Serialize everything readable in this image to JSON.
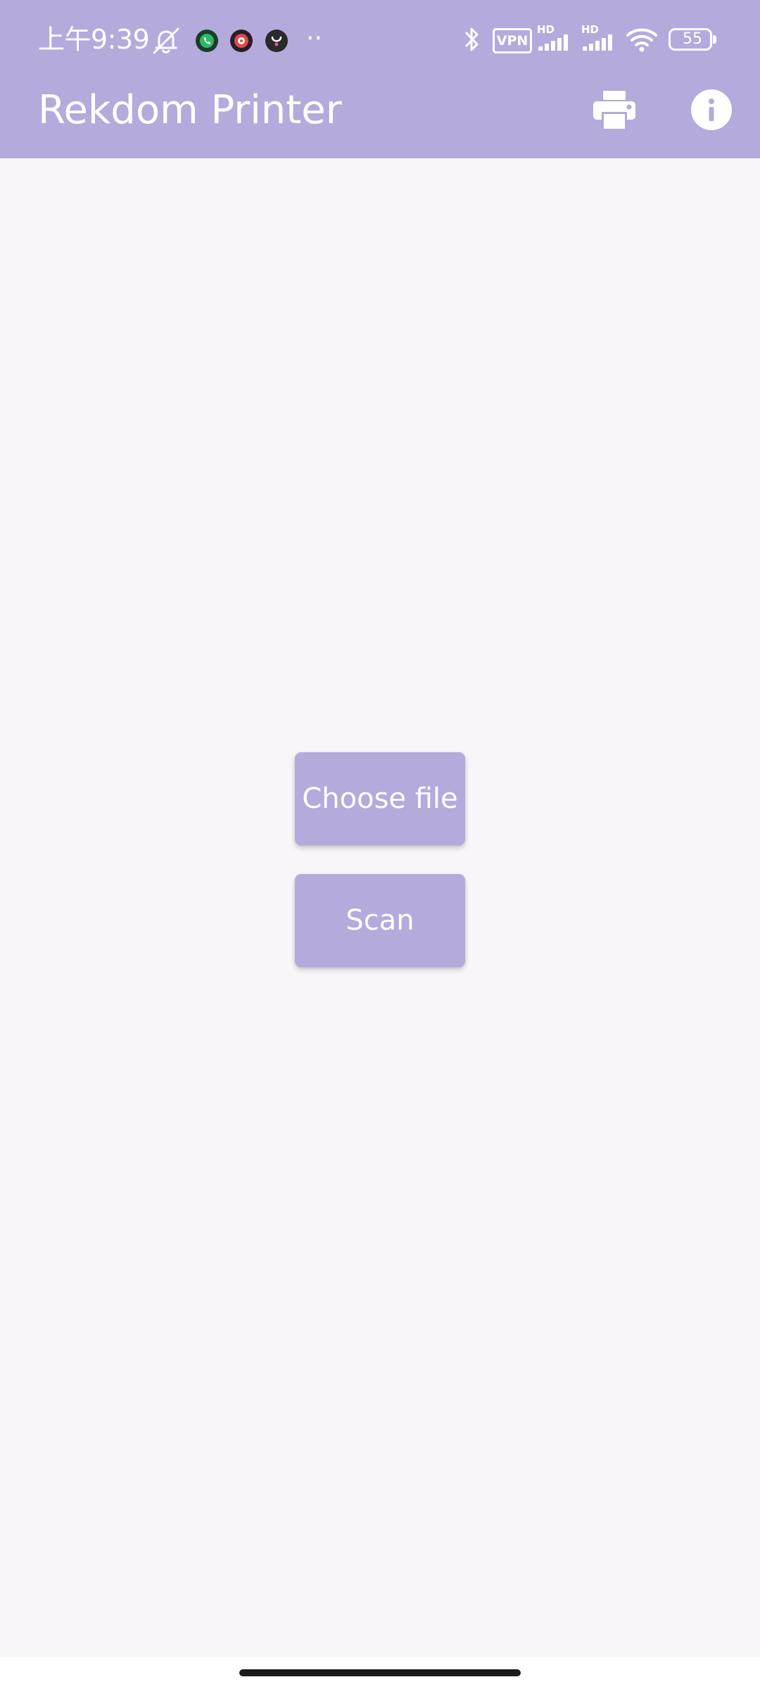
{
  "status_bar": {
    "time": "上午9:39",
    "vpn_label": "VPN",
    "signal_1_label": "HD",
    "signal_2_label": "HD",
    "battery_level": "55",
    "overflow_dots": "··"
  },
  "toolbar": {
    "title": "Rekdom Printer",
    "print_icon": "printer-icon",
    "info_icon": "info-icon"
  },
  "actions": {
    "choose_file_label": "Choose file",
    "scan_label": "Scan"
  },
  "colors": {
    "primary": "#b4aadc",
    "background": "#f8f6f9",
    "on_primary": "#ffffff"
  }
}
